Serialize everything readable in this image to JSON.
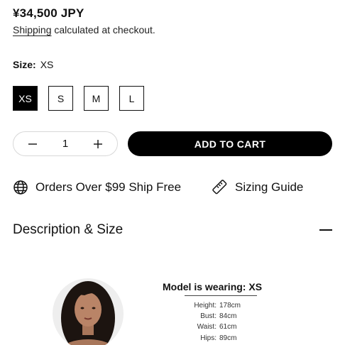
{
  "product": {
    "price": "¥34,500 JPY",
    "shipping_link": "Shipping",
    "shipping_rest": " calculated at checkout."
  },
  "size": {
    "label": "Size:",
    "selected": "XS",
    "options": [
      "XS",
      "S",
      "M",
      "L"
    ]
  },
  "quantity": {
    "value": "1"
  },
  "cart": {
    "add_label": "ADD TO CART"
  },
  "features": {
    "shipping": "Orders Over $99 Ship Free",
    "sizing": "Sizing Guide"
  },
  "accordion": {
    "title": "Description & Size"
  },
  "model": {
    "title": "Model is wearing: XS",
    "measurements": [
      {
        "key": "Height:",
        "value": "178cm"
      },
      {
        "key": "Bust:",
        "value": "84cm"
      },
      {
        "key": "Waist:",
        "value": "61cm"
      },
      {
        "key": "Hips:",
        "value": "89cm"
      }
    ]
  },
  "colors": {
    "accent": "#000000",
    "border": "#d8d8d8",
    "text": "#111111"
  },
  "icons": {
    "globe": "globe-icon",
    "ruler": "ruler-icon",
    "minus": "minus-icon",
    "plus": "plus-icon"
  }
}
